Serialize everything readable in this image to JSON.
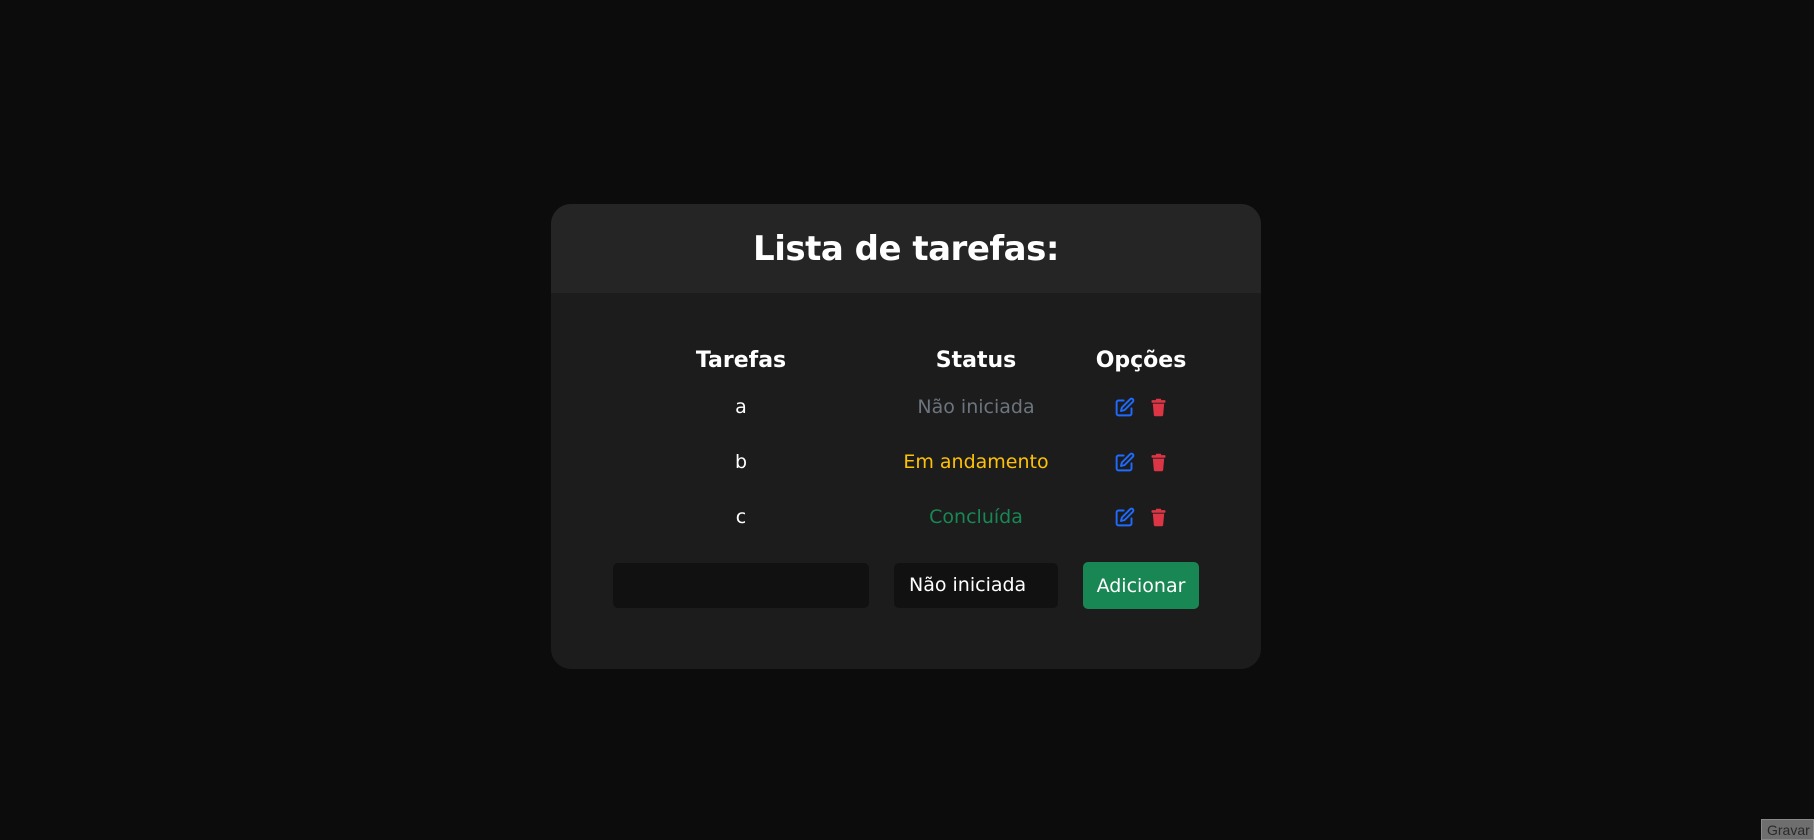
{
  "card": {
    "title": "Lista de tarefas:"
  },
  "table": {
    "headers": {
      "task": "Tarefas",
      "status": "Status",
      "options": "Opções"
    },
    "rows": [
      {
        "task": "a",
        "status": "Não iniciada",
        "status_color": "#6c757d"
      },
      {
        "task": "b",
        "status": "Em andamento",
        "status_color": "#ffc107"
      },
      {
        "task": "c",
        "status": "Concluída",
        "status_color": "#198754"
      }
    ],
    "icons": {
      "edit": "edit-icon",
      "delete": "trash-icon",
      "edit_color": "#0d6efd",
      "delete_color": "#dc3545"
    }
  },
  "form": {
    "task_input_value": "",
    "task_input_placeholder": "",
    "status_selected": "Não iniciada",
    "add_label": "Adicionar",
    "add_color": "#198754"
  },
  "corner": {
    "label": "Gravar"
  }
}
